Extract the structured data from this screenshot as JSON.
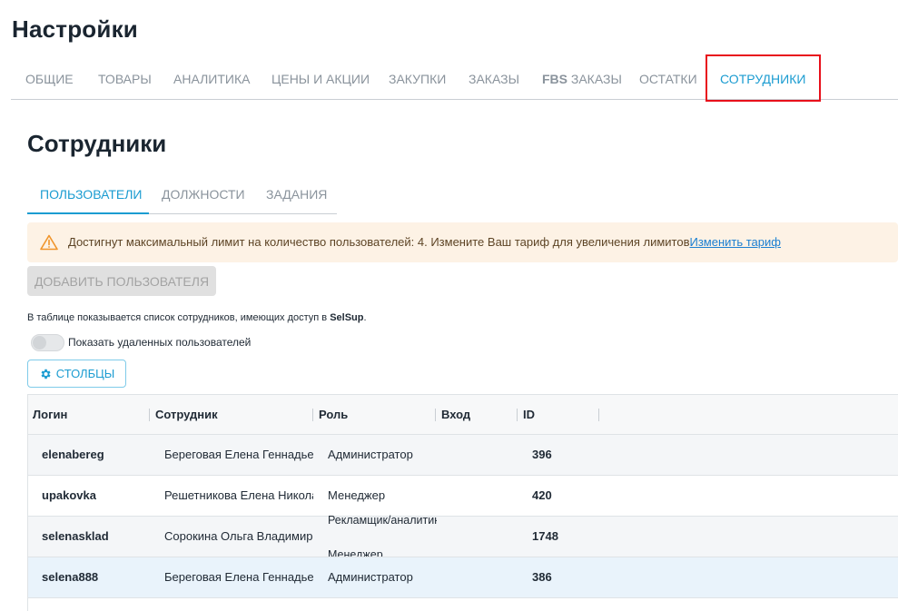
{
  "page": {
    "title": "Настройки"
  },
  "top_tabs": [
    {
      "label": "ОБЩИЕ"
    },
    {
      "label": "ТОВАРЫ"
    },
    {
      "label": "АНАЛИТИКА"
    },
    {
      "label": "ЦЕНЫ И АКЦИИ"
    },
    {
      "label": "ЗАКУПКИ"
    },
    {
      "label": "ЗАКАЗЫ"
    },
    {
      "label_bold": "FBS",
      "label_rest": " ЗАКАЗЫ"
    },
    {
      "label": "ОСТАТКИ"
    },
    {
      "label": "СОТРУДНИКИ",
      "active": true
    }
  ],
  "section": {
    "title": "Сотрудники"
  },
  "sub_tabs": [
    {
      "label": "ПОЛЬЗОВАТЕЛИ",
      "active": true
    },
    {
      "label": "ДОЛЖНОСТИ"
    },
    {
      "label": "ЗАДАНИЯ"
    }
  ],
  "alert": {
    "icon": "warning-triangle-icon",
    "text": "Достигнут максимальный лимит на количество пользователей: 4. Измените Ваш тариф для увеличения лимитов",
    "link": "Изменить тариф"
  },
  "add_user_button": "ДОБАВИТЬ ПОЛЬЗОВАТЕЛЯ",
  "info": {
    "text": "В таблице показывается список сотрудников, имеющих доступ в ",
    "brand": "SelSup",
    "suffix": "."
  },
  "toggle": {
    "label": "Показать удаленных пользователей",
    "on": false
  },
  "columns_button": {
    "label": "СТОЛБЦЫ",
    "icon": "gear-icon"
  },
  "table": {
    "headers": {
      "login": "Логин",
      "employee": "Сотрудник",
      "role": "Роль",
      "entry": "Вход",
      "id": "ID"
    },
    "rows": [
      {
        "login": "elenabereg",
        "employee": "Береговая Елена Геннадьевна",
        "role": "Администратор",
        "entry": "",
        "id": "396"
      },
      {
        "login": "upakovka",
        "employee": "Решетникова Елена Николаевна",
        "role": "Менеджер",
        "entry": "",
        "id": "420"
      },
      {
        "login": "selenasklad",
        "employee": "Сорокина Ольга Владимировна",
        "role": "Рекламщик/аналитик",
        "role2": "Менеджер",
        "entry": "",
        "id": "1748"
      },
      {
        "login": "selena888",
        "employee": "Береговая Елена Геннадьевна",
        "role": "Администратор",
        "entry": "",
        "id": "386"
      }
    ]
  },
  "colors": {
    "accent": "#1b9cd1",
    "highlight": "#e8101b",
    "alert_bg": "#fdf2e5"
  }
}
